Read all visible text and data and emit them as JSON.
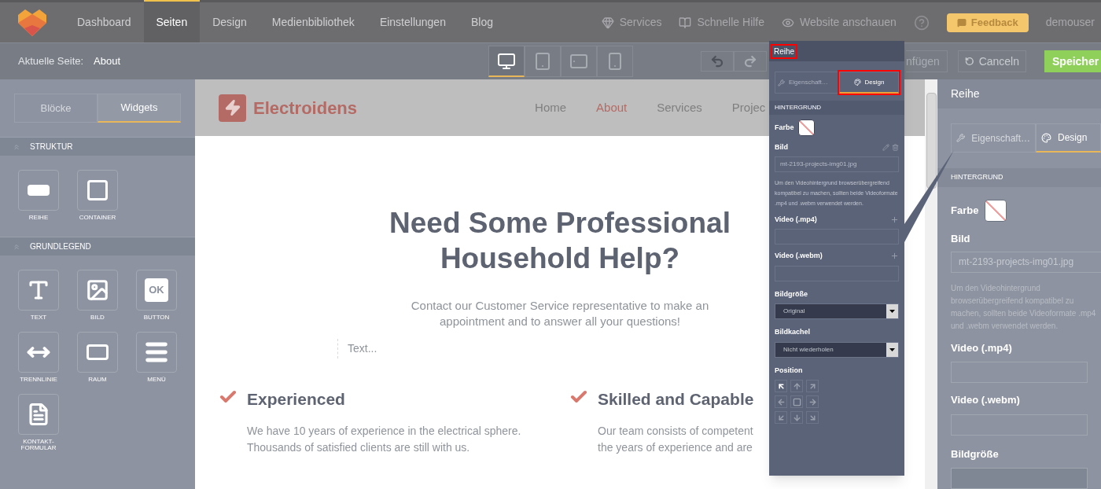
{
  "top_nav": {
    "items": [
      {
        "label": "Dashboard",
        "selected": false
      },
      {
        "label": "Seiten",
        "selected": true
      },
      {
        "label": "Design",
        "selected": false
      },
      {
        "label": "Medienbibliothek",
        "selected": false
      },
      {
        "label": "Einstellungen",
        "selected": false
      },
      {
        "label": "Blog",
        "selected": false
      }
    ],
    "links": [
      {
        "kind": "services",
        "label": "Services"
      },
      {
        "kind": "help",
        "label": "Schnelle Hilfe"
      },
      {
        "kind": "view",
        "label": "Website anschauen"
      }
    ],
    "feedback": "Feedback",
    "user": "demouser"
  },
  "toolbar": {
    "current_label": "Aktuelle Seite:",
    "current_page": "About",
    "devices": [
      {
        "kind": "desktop",
        "selected": true
      },
      {
        "kind": "tablet",
        "selected": false
      },
      {
        "kind": "landscape",
        "selected": false
      },
      {
        "kind": "phone",
        "selected": false
      }
    ],
    "insert": "nfügen",
    "cancel": "Canceln",
    "save": "Speicher"
  },
  "sidebar": {
    "tabs": [
      {
        "label": "Blöcke",
        "selected": false
      },
      {
        "label": "Widgets",
        "selected": true
      }
    ],
    "sections": [
      {
        "title": "STRUKTUR",
        "expanded": true,
        "widgets": [
          {
            "kind": "row",
            "label": "REIHE"
          },
          {
            "kind": "container",
            "label": "CONTAINER"
          }
        ]
      },
      {
        "title": "GRUNDLEGEND",
        "expanded": true,
        "widgets": [
          {
            "kind": "text",
            "label": "TEXT"
          },
          {
            "kind": "image",
            "label": "BILD"
          },
          {
            "kind": "button",
            "label": "BUTTON",
            "icon_text": "OK"
          },
          {
            "kind": "divider",
            "label": "TRENNLINIE"
          },
          {
            "kind": "space",
            "label": "RAUM"
          },
          {
            "kind": "menu",
            "label": "MENÜ"
          },
          {
            "kind": "form",
            "label": "KONTAKT-FORMULAR"
          }
        ]
      }
    ]
  },
  "preview": {
    "logo": "Electroidens",
    "nav": [
      {
        "label": "Home",
        "selected": false
      },
      {
        "label": "About",
        "selected": true
      },
      {
        "label": "Services",
        "selected": false
      },
      {
        "label": "Projec",
        "selected": false
      }
    ],
    "heading": "Need Some Professional Household Help?",
    "text": "Contact our Customer Service representative to make an appointment and to answer all your questions!",
    "placeholder": "Text...",
    "features": [
      {
        "title": "Experienced",
        "lines": [
          "We have 10 years of experience in the electrical sphere.",
          "Thousands of satisfied clients are still with us."
        ]
      },
      {
        "title": "Skilled and Capable",
        "lines": [
          "Our team consists of competent",
          "the years of experience and are"
        ]
      }
    ]
  },
  "right_panel": {
    "title": "Reihe",
    "tabs": [
      {
        "kind": "wrench",
        "label": "Eigenschaft…",
        "selected": false
      },
      {
        "kind": "palette",
        "label": "Design",
        "selected": true
      }
    ],
    "section": "HINTERGRUND",
    "color_label": "Farbe",
    "image_label": "Bild",
    "image_value": "mt-2193-projects-img01.jpg",
    "help": "Um den Videohintergrund browserübergreifend kompatibel zu machen, sollten beide Videoformate .mp4 und .webm verwendet werden.",
    "video_mp4": "Video (.mp4)",
    "video_webm": "Video (.webm)",
    "size_label": "Bildgröße"
  },
  "callout": {
    "title": "Reihe",
    "title_highlighted": true,
    "tabs": [
      {
        "kind": "wrench",
        "label": "Eigenschaft…",
        "selected": false,
        "highlighted": false
      },
      {
        "kind": "palette",
        "label": "Design",
        "selected": true,
        "highlighted": true
      }
    ],
    "section": "HINTERGRUND",
    "color_label": "Farbe",
    "image_label": "Bild",
    "image_value": "mt-2193-projects-img01.jpg",
    "help": "Um den Videohintergrund browserübergreifend kompatibel zu machen, sollten beide Videoformate .mp4 und .webm verwendet werden.",
    "video_mp4": "Video (.mp4)",
    "video_webm": "Video (.webm)",
    "size_label": "Bildgröße",
    "size_value": "Original",
    "tile_label": "Bildkachel",
    "tile_value": "Nicht wiederholen",
    "position_label": "Position",
    "positions": [
      {
        "kind": "nw",
        "selected": true
      },
      {
        "kind": "n",
        "selected": false
      },
      {
        "kind": "ne",
        "selected": false
      },
      {
        "kind": "w",
        "selected": false
      },
      {
        "kind": "c",
        "selected": false
      },
      {
        "kind": "e",
        "selected": false
      },
      {
        "kind": "sw",
        "selected": false
      },
      {
        "kind": "s",
        "selected": false
      },
      {
        "kind": "se",
        "selected": false
      }
    ]
  }
}
